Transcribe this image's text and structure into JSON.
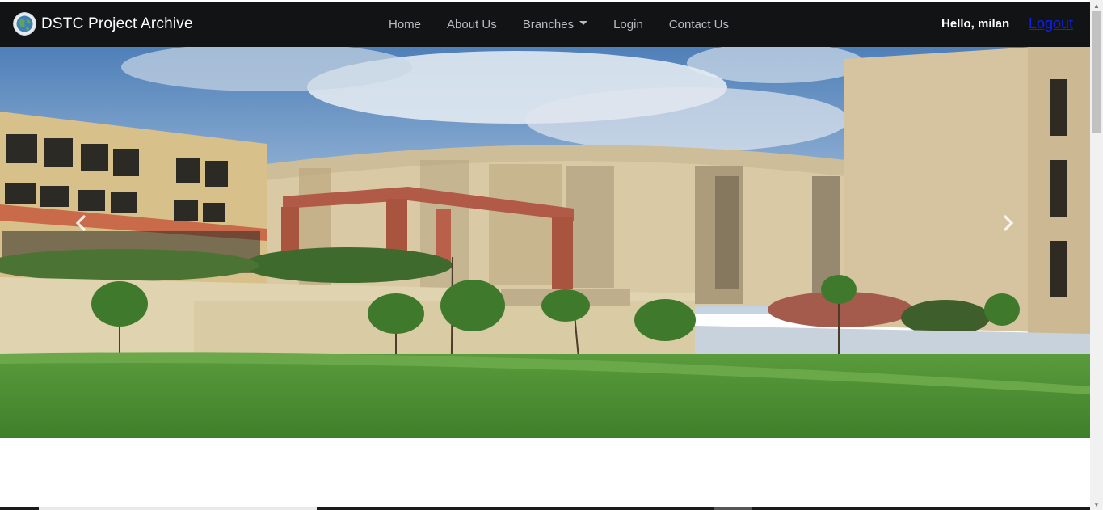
{
  "brand": {
    "title": "DSTC Project Archive"
  },
  "nav": {
    "home": "Home",
    "about": "About Us",
    "branches": "Branches",
    "login": "Login",
    "contact": "Contact Us"
  },
  "user": {
    "greeting": "Hello, milan",
    "logout": "Logout"
  },
  "carousel": {
    "prev_icon": "chevron-left-icon",
    "next_icon": "chevron-right-icon"
  },
  "colors": {
    "navbar": "#111315",
    "nav_text": "#b9bcbf",
    "logout_link": "#0d20f2"
  }
}
